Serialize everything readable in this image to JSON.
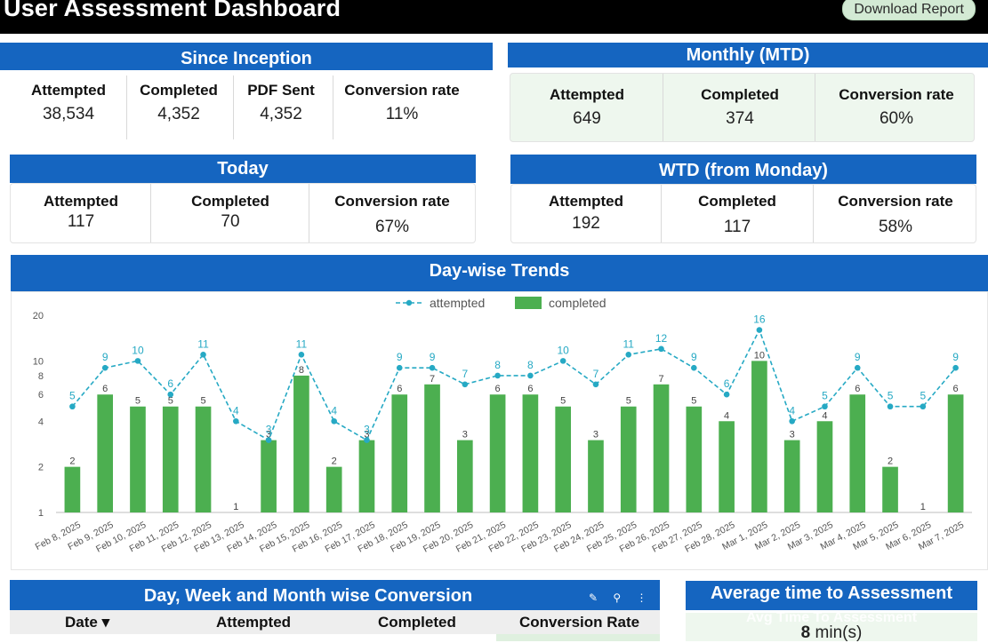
{
  "header": {
    "title": "User Assessment Dashboard",
    "download_label": "Download Report"
  },
  "since_inception": {
    "title": "Since Inception",
    "metrics": [
      {
        "label": "Attempted",
        "value": "38,534"
      },
      {
        "label": "Completed",
        "value": "4,352"
      },
      {
        "label": "PDF Sent",
        "value": "4,352"
      },
      {
        "label": "Conversion rate",
        "value": "11%"
      }
    ]
  },
  "monthly": {
    "title": "Monthly (MTD)",
    "metrics": [
      {
        "label": "Attempted",
        "value": "649"
      },
      {
        "label": "Completed",
        "value": "374"
      },
      {
        "label": "Conversion rate",
        "value": "60%"
      }
    ]
  },
  "today": {
    "title": "Today",
    "metrics": [
      {
        "label": "Attempted",
        "value": "117"
      },
      {
        "label": "Completed",
        "value": "70"
      },
      {
        "label": "Conversion rate",
        "value": "67%"
      }
    ]
  },
  "wtd": {
    "title": "WTD (from Monday)",
    "metrics": [
      {
        "label": "Attempted",
        "value": "192"
      },
      {
        "label": "Completed",
        "value": "117"
      },
      {
        "label": "Conversion rate",
        "value": "58%"
      }
    ]
  },
  "trends": {
    "title": "Day-wise Trends"
  },
  "chart_data": {
    "type": "bar",
    "title": "Day-wise Trends",
    "categories": [
      "Feb 8, 2025",
      "Feb 9, 2025",
      "Feb 10, 2025",
      "Feb 11, 2025",
      "Feb 12, 2025",
      "Feb 13, 2025",
      "Feb 14, 2025",
      "Feb 15, 2025",
      "Feb 16, 2025",
      "Feb 17, 2025",
      "Feb 18, 2025",
      "Feb 19, 2025",
      "Feb 20, 2025",
      "Feb 21, 2025",
      "Feb 22, 2025",
      "Feb 23, 2025",
      "Feb 24, 2025",
      "Feb 25, 2025",
      "Feb 26, 2025",
      "Feb 27, 2025",
      "Feb 28, 2025",
      "Mar 1, 2025",
      "Mar 2, 2025",
      "Mar 3, 2025",
      "Mar 4, 2025",
      "Mar 5, 2025",
      "Mar 6, 2025",
      "Mar 7, 2025"
    ],
    "series": [
      {
        "name": "attempted",
        "type": "line",
        "color": "#26a9c4",
        "values": [
          5,
          9,
          10,
          6,
          11,
          4,
          3,
          11,
          4,
          3,
          9,
          9,
          7,
          8,
          8,
          10,
          7,
          11,
          12,
          9,
          6,
          16,
          4,
          5,
          9,
          5,
          5,
          9
        ],
        "labels": [
          "5",
          "9",
          "10",
          "6",
          "11",
          "4",
          "3",
          "11",
          "4",
          "3",
          "9",
          "9",
          "7",
          "8",
          "8",
          "10",
          "7",
          "11",
          "12",
          "9",
          "6",
          "16",
          "4",
          "5",
          "9",
          "5",
          "5",
          "9"
        ]
      },
      {
        "name": "completed",
        "type": "bar",
        "color": "#4caf50",
        "values": [
          2,
          6,
          5,
          5,
          5,
          1,
          3,
          8,
          2,
          3,
          6,
          7,
          3,
          6,
          6,
          5,
          3,
          5,
          7,
          5,
          4,
          10,
          3,
          4,
          6,
          2,
          1,
          6
        ]
      }
    ],
    "y_scale": "log",
    "yticks": [
      1,
      2,
      4,
      6,
      8,
      10,
      20
    ],
    "ylim": [
      1,
      20
    ],
    "legend": "top"
  },
  "conversion_table": {
    "title": "Day, Week and Month wise Conversion",
    "columns": [
      "Date ▾",
      "Attempted",
      "Completed",
      "Conversion Rate"
    ]
  },
  "avg_time": {
    "title": "Average time to Assessment",
    "ghost_label": "Avg Time To Assessment",
    "value": "8",
    "unit": " min(s)"
  }
}
